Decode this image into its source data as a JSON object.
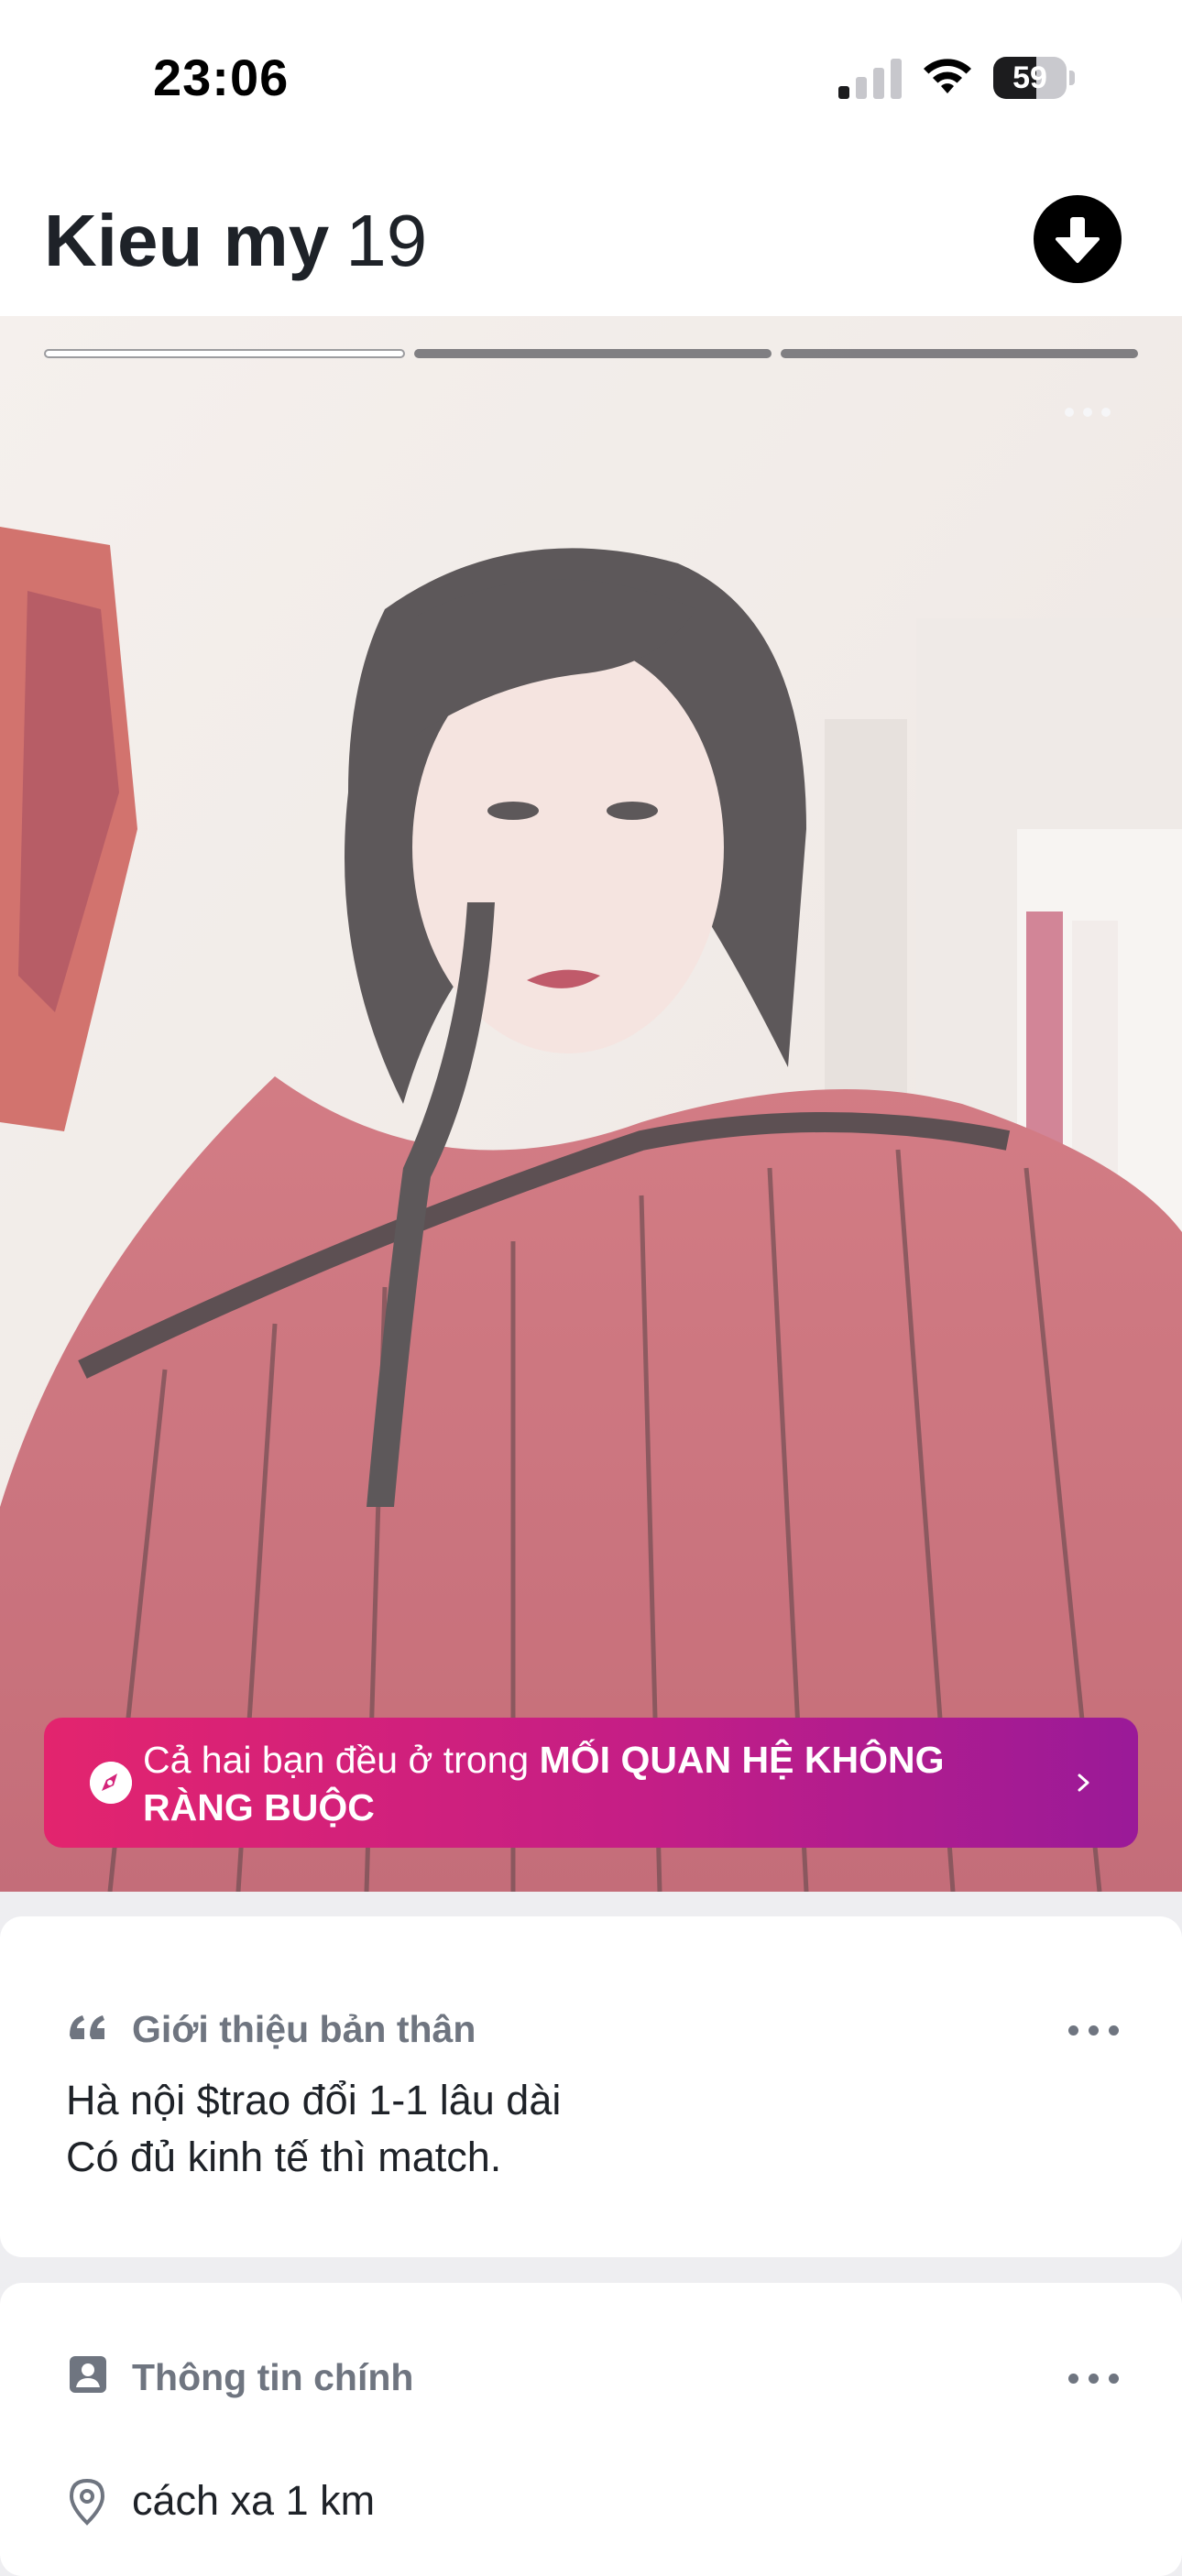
{
  "status_bar": {
    "time": "23:06",
    "battery_level": "59"
  },
  "profile": {
    "name": "Kieu my",
    "age": "19",
    "photo_count": 3,
    "active_photo": 1
  },
  "banner": {
    "text_prefix": "Cả hai bạn đều ở trong ",
    "text_bold": "MỐI QUAN HỆ KHÔNG RÀNG BUỘC"
  },
  "about": {
    "title": "Giới thiệu bản thân",
    "lines": [
      "Hà nội $trao đổi 1-1 lâu dài",
      "Có đủ kinh tế thì match."
    ]
  },
  "basic_info": {
    "title": "Thông tin chính",
    "distance": "cách xa 1 km"
  },
  "colors": {
    "banner_start": "#e3246e",
    "banner_end": "#9a1a98",
    "secondary_text": "#6f7580",
    "primary_text": "#1e2228"
  },
  "icons": [
    "wifi-icon",
    "battery-icon",
    "arrow-down-icon",
    "more-icon",
    "compass-icon",
    "chevron-right-icon",
    "quote-icon",
    "profile-card-icon",
    "location-pin-icon"
  ]
}
